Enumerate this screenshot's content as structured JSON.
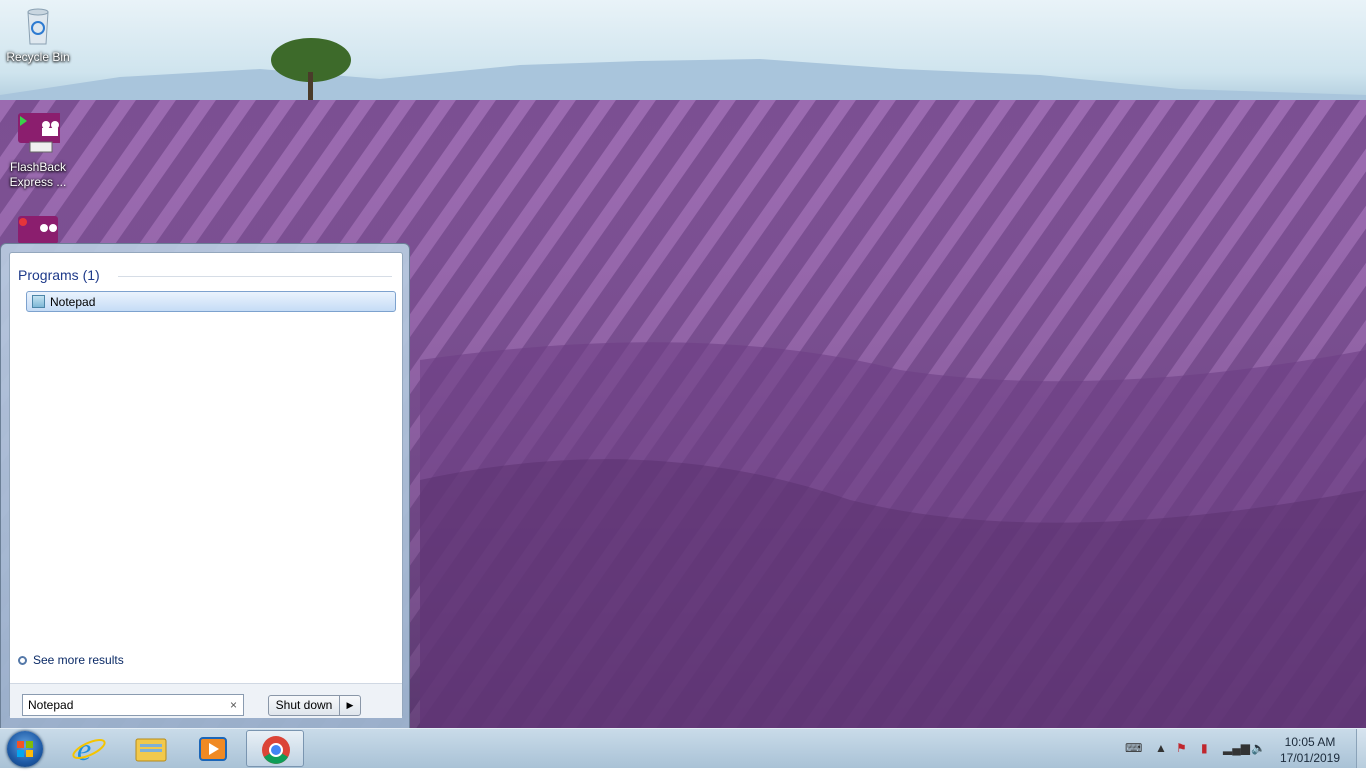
{
  "desktop": {
    "icons": [
      {
        "label": "Recycle Bin"
      },
      {
        "label": "FlashBack Express ..."
      },
      {
        "label": ""
      }
    ]
  },
  "start_menu": {
    "section_header": "Programs (1)",
    "results": [
      {
        "label": "Notepad"
      }
    ],
    "see_more": "See more results",
    "search_value": "Notepad",
    "shutdown_label": "Shut down"
  },
  "taskbar": {
    "pinned": [
      "internet-explorer-icon",
      "windows-explorer-icon",
      "media-player-icon",
      "chrome-icon"
    ],
    "active": "chrome-icon"
  },
  "clock": {
    "time": "10:05 AM",
    "date": "17/01/2019"
  }
}
